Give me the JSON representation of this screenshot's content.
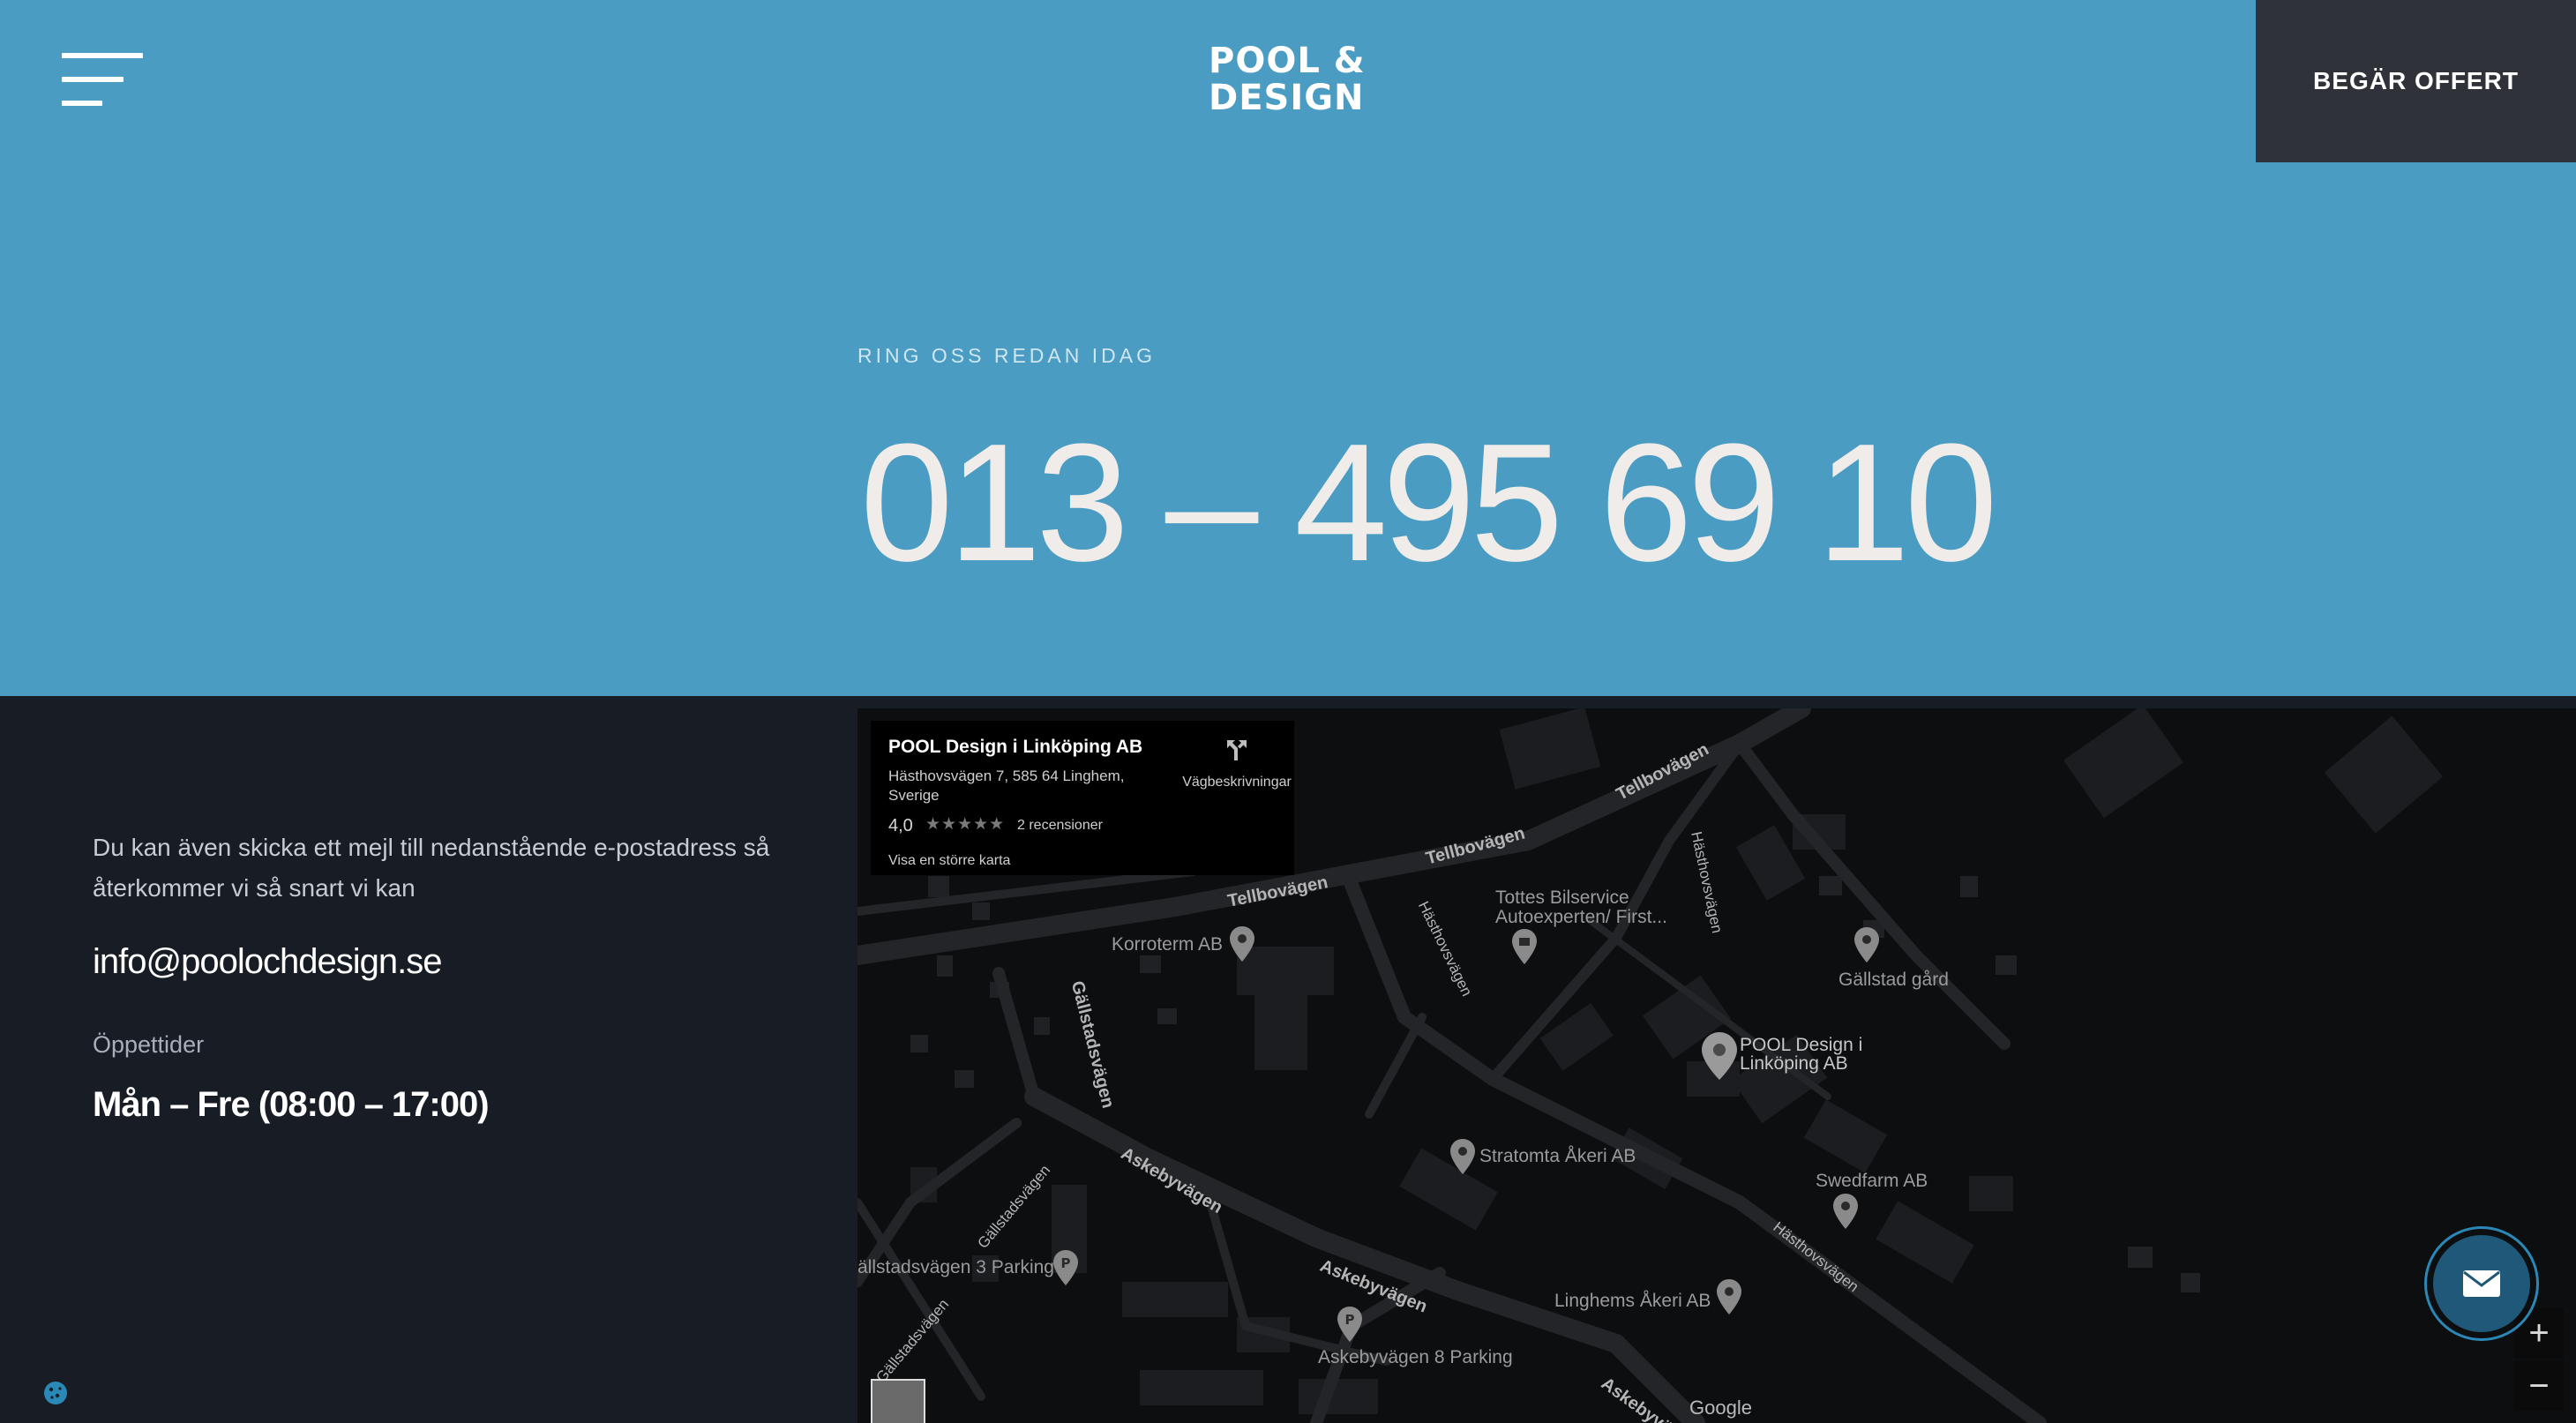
{
  "header": {
    "logo_line1": "POOL &",
    "logo_line2": "DESIGN",
    "cta_label": "BEGÄR OFFERT"
  },
  "hero": {
    "eyebrow": "RING OSS REDAN IDAG",
    "phone": "013 – 495 69 10"
  },
  "contact": {
    "description": "Du kan även skicka ett mejl till nedanstående e-postadress så återkommer vi så snart vi kan",
    "email": "info@poolochdesign.se",
    "hours_label": "Öppettider",
    "hours": "Mån – Fre (08:00 – 17:00)"
  },
  "map": {
    "card": {
      "name": "POOL Design i Linköping AB",
      "address": "Hästhovsvägen 7, 585 64 Linghem, Sverige",
      "rating": "4,0",
      "stars": "★★★★★",
      "reviews": "2 recensioner",
      "larger_map": "Visa en större karta",
      "directions": "Vägbeskrivningar"
    },
    "places": {
      "korroterm": "Korroterm AB",
      "tottes1": "Tottes Bilservice",
      "tottes2": "Autoexperten/ First...",
      "gallstad_gard": "Gällstad gård",
      "pool1": "POOL Design i",
      "pool2": "Linköping AB",
      "stratomta": "Stratomta Åkeri AB",
      "swedfarm": "Swedfarm AB",
      "linghems": "Linghems Åkeri AB",
      "parking3": "ällstadsvägen 3 Parking",
      "parking8": "Askebyvägen 8 Parking"
    },
    "streets": {
      "tellbo1": "Tellbovägen",
      "tellbo2": "Tellbovägen",
      "tellbo3": "Tellbovägen",
      "hasthovs1": "Hästhovsvägen",
      "hasthovs2": "Hästhovsvägen",
      "hasthovs3": "Hästhovsvägen",
      "gallstads1": "Gällstadsvägen",
      "gallstads2": "Gällstadsvägen",
      "gallstads3": "Gällstadsvägen",
      "askeby1": "Askebyvägen",
      "askeby2": "Askebyvägen",
      "askeby3": "Askebyvägen"
    },
    "zoom_in": "+",
    "zoom_out": "−",
    "google": "Google"
  },
  "colors": {
    "hero_bg": "#4a9cc2",
    "footer_bg": "#181d25",
    "cta_bg": "#2f3239",
    "map_bg": "#0d0e10",
    "accent": "#2a88b6"
  },
  "icons": [
    "menu-icon",
    "directions-icon",
    "mail-icon",
    "cookie-icon",
    "map-pin-icon",
    "parking-icon",
    "shop-icon"
  ]
}
